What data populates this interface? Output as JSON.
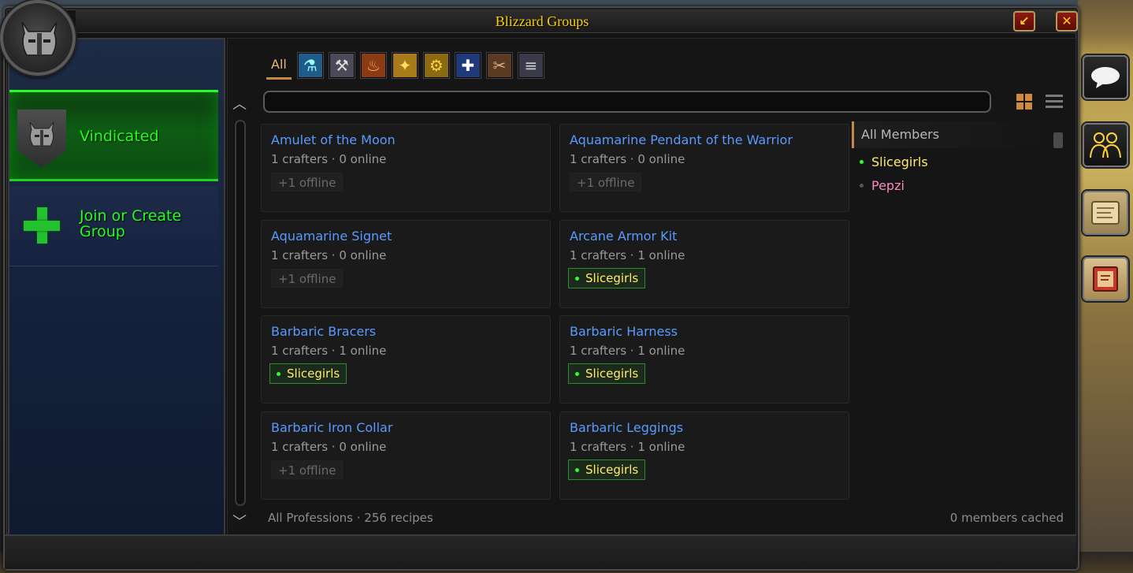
{
  "window": {
    "title": "Blizzard Groups",
    "minimize_glyph": "↙",
    "close_glyph": "✕"
  },
  "groups": [
    {
      "name": "Vindicated",
      "active": true,
      "icon": "helmet-icon"
    },
    {
      "name": "Join or Create Group",
      "active": false,
      "icon": "plus-icon"
    }
  ],
  "tabs": {
    "all_label": "All",
    "professions": [
      {
        "icon": "alchemy-icon",
        "glyph": "⚗",
        "color": "#1f5c8a"
      },
      {
        "icon": "blacksmithing-icon",
        "glyph": "⚒",
        "color": "#4a4a58"
      },
      {
        "icon": "cooking-icon",
        "glyph": "🍗",
        "color": "#8a3a14"
      },
      {
        "icon": "enchanting-icon",
        "glyph": "✦",
        "color": "#a87a1c"
      },
      {
        "icon": "engineering-icon",
        "glyph": "⚙",
        "color": "#8a6a12"
      },
      {
        "icon": "first-aid-icon",
        "glyph": "✚",
        "color": "#1e3a7a"
      },
      {
        "icon": "leatherworking-icon",
        "glyph": "✂",
        "color": "#5a3a22"
      },
      {
        "icon": "tailoring-icon",
        "glyph": "🧵",
        "color": "#3a3a4a"
      }
    ]
  },
  "search": {
    "value": "",
    "placeholder": ""
  },
  "recipes": [
    {
      "name": "Amulet of the Moon",
      "summary": "1 crafters · 0 online",
      "crafter": "+1 offline",
      "online": false
    },
    {
      "name": "Aquamarine Pendant of the Warrior",
      "summary": "1 crafters · 0 online",
      "crafter": "+1 offline",
      "online": false
    },
    {
      "name": "Aquamarine Signet",
      "summary": "1 crafters · 0 online",
      "crafter": "+1 offline",
      "online": false
    },
    {
      "name": "Arcane Armor Kit",
      "summary": "1 crafters · 1 online",
      "crafter": "Slicegirls",
      "online": true
    },
    {
      "name": "Barbaric Bracers",
      "summary": "1 crafters · 1 online",
      "crafter": "Slicegirls",
      "online": true
    },
    {
      "name": "Barbaric Harness",
      "summary": "1 crafters · 1 online",
      "crafter": "Slicegirls",
      "online": true
    },
    {
      "name": "Barbaric Iron Collar",
      "summary": "1 crafters · 0 online",
      "crafter": "+1 offline",
      "online": false
    },
    {
      "name": "Barbaric Leggings",
      "summary": "1 crafters · 1 online",
      "crafter": "Slicegirls",
      "online": true
    }
  ],
  "members": {
    "header": "All Members",
    "list": [
      {
        "name": "Slicegirls",
        "online": true,
        "color": "#ffeb6a"
      },
      {
        "name": "Pepzi",
        "online": false,
        "color": "#f48cba"
      }
    ]
  },
  "footer": {
    "left": "All Professions · 256 recipes",
    "right": "0 members cached"
  },
  "side_buttons": [
    "chat-icon",
    "social-icon",
    "map-icon",
    "spellbook-icon"
  ]
}
